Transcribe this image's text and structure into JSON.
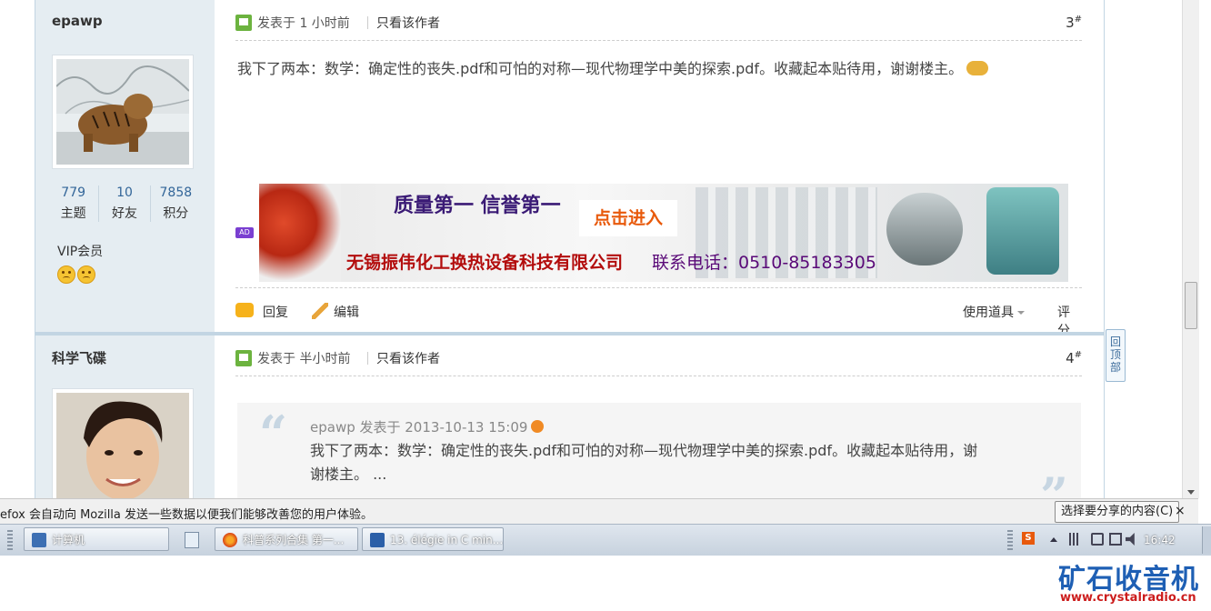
{
  "posts": [
    {
      "username": "epawp",
      "stats": [
        {
          "value": "779",
          "label": "主题"
        },
        {
          "value": "10",
          "label": "好友"
        },
        {
          "value": "7858",
          "label": "积分"
        }
      ],
      "rank": "VIP会员",
      "posted": "发表于 1 小时前",
      "only_author": "只看该作者",
      "floor": "3",
      "floor_sup": "#",
      "content": "我下了两本：数学：确定性的丧失.pdf和可怕的对称—现代物理学中美的探索.pdf。收藏起本贴待用，谢谢楼主。",
      "ad": {
        "tag": "AD",
        "slogan": "质量第一 信誉第一",
        "button": "点击进入",
        "company": "无锡振伟化工换热设备科技有限公司",
        "phone": "联系电话：0510-85183305"
      },
      "actions": {
        "reply": "回复",
        "edit": "编辑",
        "tools": "使用道具",
        "rate": "评分"
      }
    },
    {
      "username": "科学飞碟",
      "posted": "发表于 半小时前",
      "only_author": "只看该作者",
      "floor": "4",
      "floor_sup": "#",
      "quote": {
        "header": "epawp 发表于 2013-10-13 15:09",
        "text": "我下了两本：数学：确定性的丧失.pdf和可怕的对称—现代物理学中美的探索.pdf。收藏起本贴待用，谢谢楼主。 ..."
      }
    }
  ],
  "back_to_top": "回顶部",
  "notification": {
    "text": "efox 会自动向 Mozilla 发送一些数据以便我们能够改善您的用户体验。",
    "button": "选择要分享的内容(C)",
    "close": "×"
  },
  "taskbar": {
    "items": [
      {
        "label": "计算机"
      },
      {
        "label": "科普系列合集 第一..."
      },
      {
        "label": "13. élégie in C min..."
      }
    ],
    "time": "16:42"
  },
  "watermark": {
    "title": "矿石收音机",
    "url": "www.crystalradio.cn"
  }
}
